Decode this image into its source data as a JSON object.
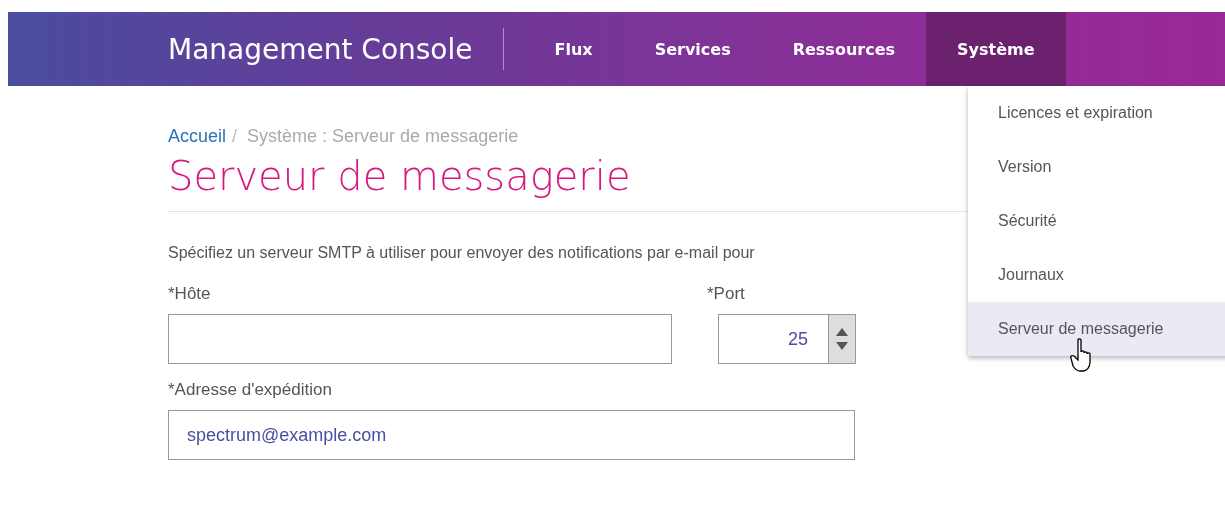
{
  "header": {
    "brand": "Management Console",
    "nav": [
      {
        "label": "Flux",
        "selected": false
      },
      {
        "label": "Services",
        "selected": false
      },
      {
        "label": "Ressources",
        "selected": false
      },
      {
        "label": "Système",
        "selected": true
      }
    ]
  },
  "dropdown": {
    "items": [
      {
        "label": "Licences et expiration",
        "selected": false
      },
      {
        "label": "Version",
        "selected": false
      },
      {
        "label": "Sécurité",
        "selected": false
      },
      {
        "label": "Journaux",
        "selected": false
      },
      {
        "label": "Serveur de messagerie",
        "selected": true
      }
    ]
  },
  "breadcrumb": {
    "link": "Accueil",
    "separator": "/",
    "current": "Système : Serveur de messagerie"
  },
  "title": "Serveur de messagerie",
  "description": "Spécifiez un serveur SMTP à utiliser pour envoyer des notifications par e-mail pour",
  "form": {
    "host": {
      "label": "*Hôte"
    },
    "port": {
      "label": "*Port",
      "value": "25"
    },
    "sender": {
      "label": "*Adresse d'expédition",
      "value": "spectrum@example.com"
    }
  }
}
